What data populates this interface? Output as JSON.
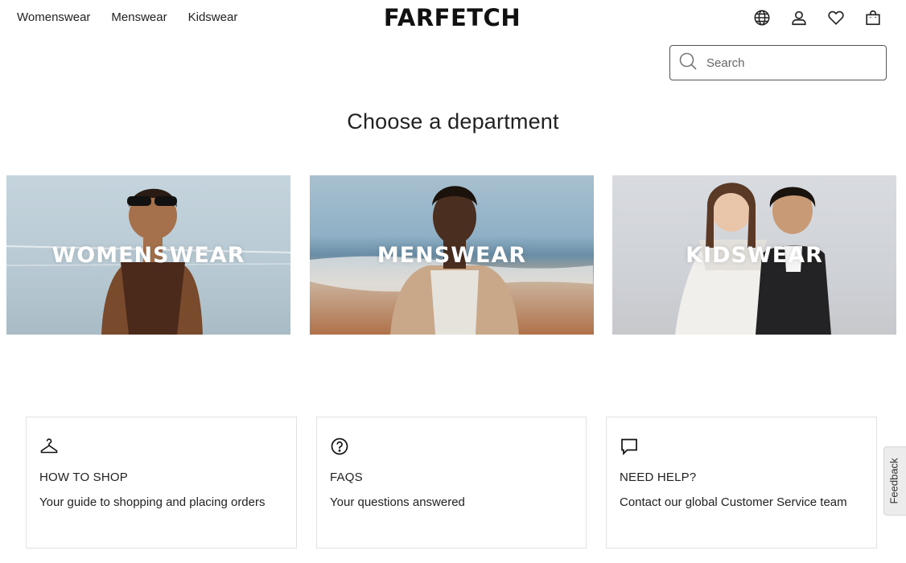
{
  "header": {
    "nav": [
      "Womenswear",
      "Menswear",
      "Kidswear"
    ],
    "logo": "FARFETCH",
    "icons": [
      "globe-icon",
      "account-icon",
      "wishlist-heart-icon",
      "shopping-bag-icon"
    ]
  },
  "search": {
    "placeholder": "Search",
    "value": ""
  },
  "main": {
    "heading": "Choose a department",
    "departments": [
      {
        "label": "WOMENSWEAR"
      },
      {
        "label": "MENSWEAR"
      },
      {
        "label": "KIDSWEAR"
      }
    ]
  },
  "help_cards": [
    {
      "icon": "hanger-icon",
      "title": "HOW TO SHOP",
      "description": "Your guide to shopping and placing orders"
    },
    {
      "icon": "question-circle-icon",
      "title": "FAQS",
      "description": "Your questions answered"
    },
    {
      "icon": "chat-bubble-icon",
      "title": "NEED HELP?",
      "description": "Contact our global Customer Service team"
    }
  ],
  "feedback_tab": {
    "label": "Feedback"
  }
}
